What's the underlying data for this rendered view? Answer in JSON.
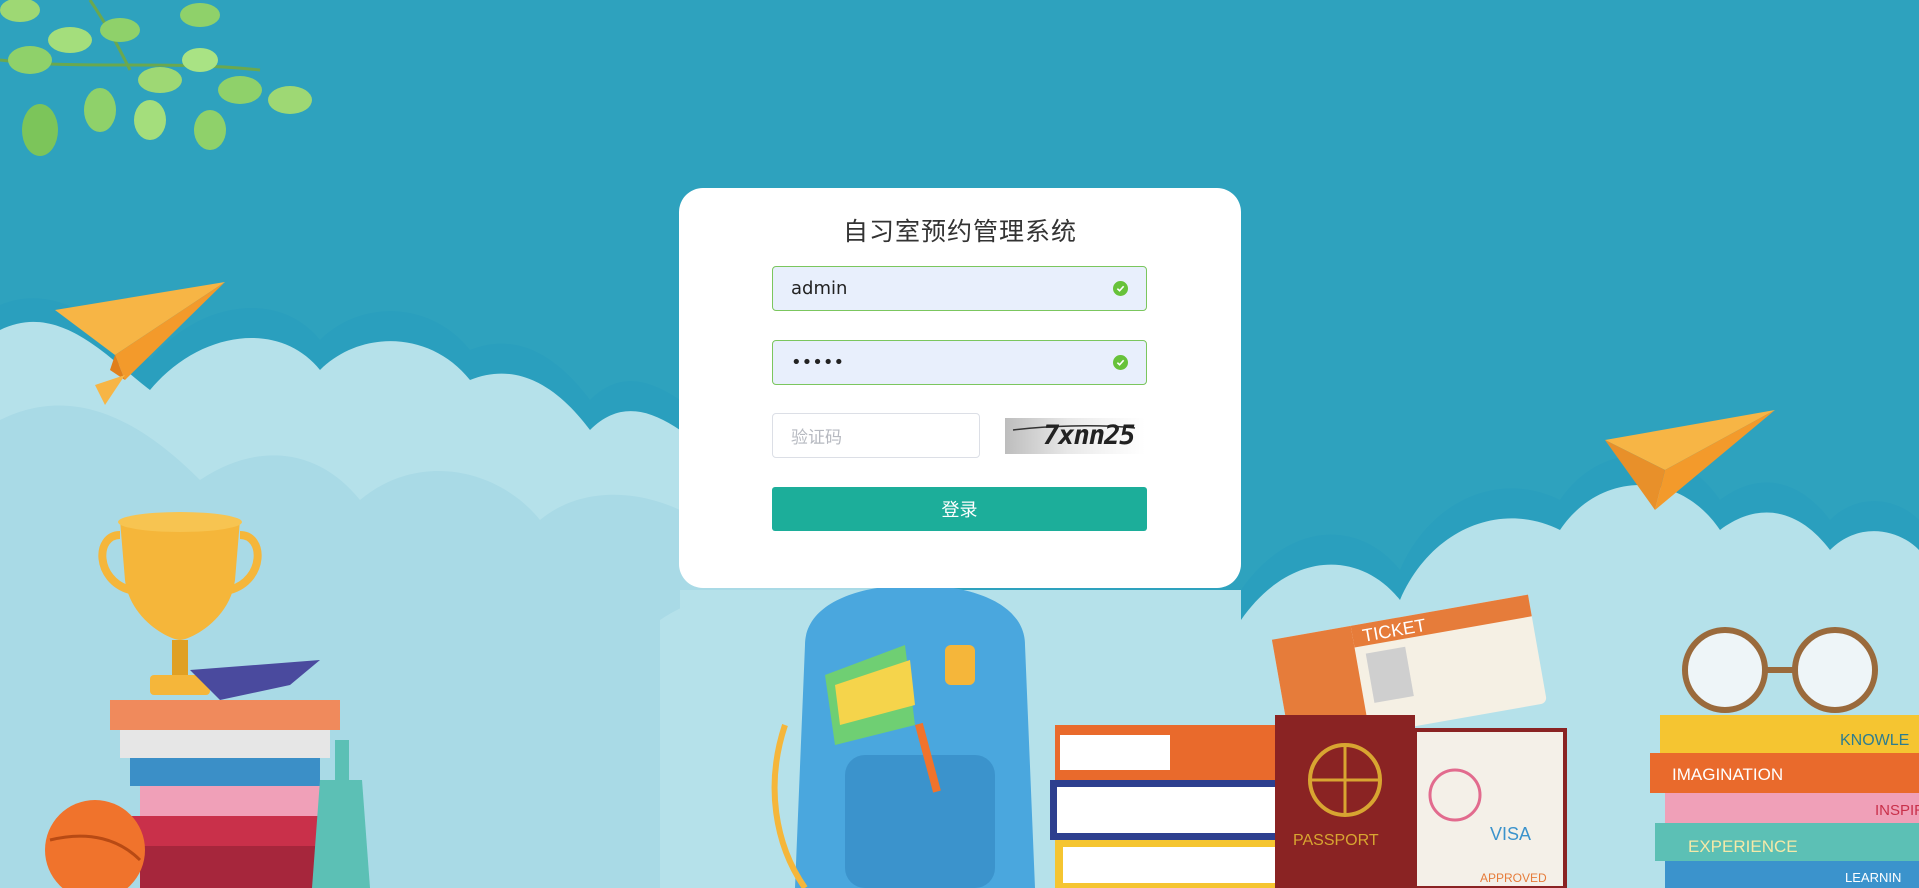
{
  "app": {
    "title": "自习室预约管理系统"
  },
  "login_form": {
    "username_value": "admin",
    "password_value": "•••••",
    "captcha_placeholder": "验证码",
    "captcha_code": "7xnn25",
    "login_button_label": "登录"
  },
  "scene": {
    "ticket_label": "TICKET",
    "passport_label": "PASSPORT",
    "visa_label_1": "VISA",
    "visa_label_2": "VISA",
    "approved_label": "APPROVED",
    "book_labels": [
      "KNOWLE",
      "IMAGINATION",
      "INSPIRAT",
      "EXPERIENCE",
      "LEARNIN"
    ]
  },
  "colors": {
    "background": "#2ea2be",
    "accent": "#1cae9a",
    "valid": "#67c23a"
  }
}
